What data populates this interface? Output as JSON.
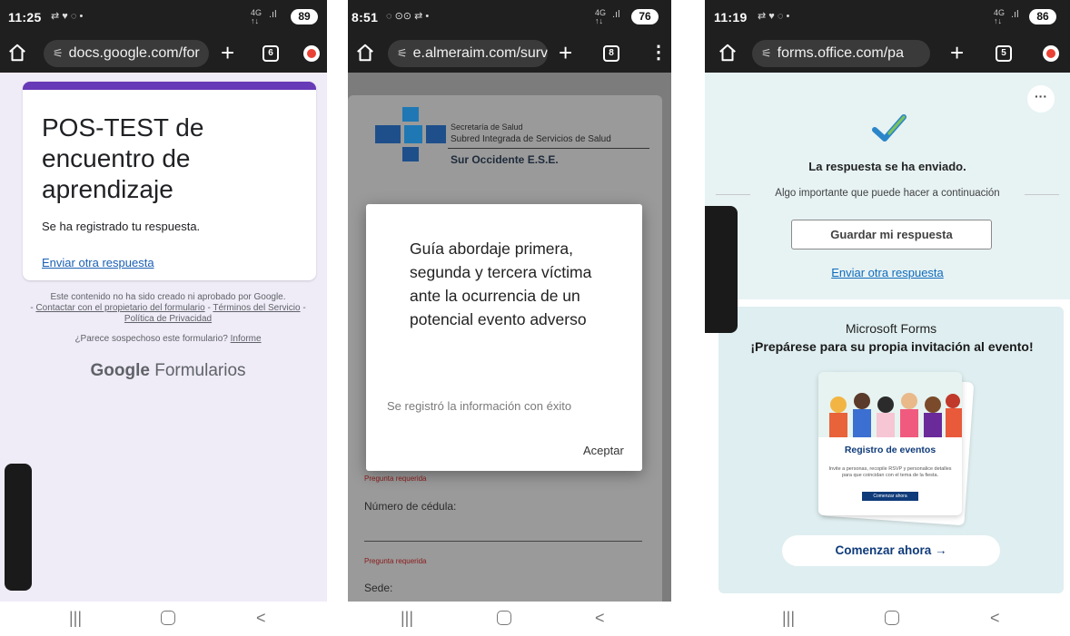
{
  "panels": {
    "google": {
      "status": {
        "time": "11:25",
        "icons": "⇄ ♥ ◌ •",
        "signal": "4G\n↑↓",
        "battery": "89"
      },
      "browser": {
        "url": "docs.google.com/for",
        "tabs_count": "6"
      },
      "form": {
        "title": "POS-TEST de encuentro de aprendizaje",
        "message": "Se ha registrado tu respuesta.",
        "link": "Enviar otra respuesta"
      },
      "footer": {
        "disclaimer_1": "Este contenido no ha sido creado ni aprobado por Google.",
        "disclaimer_2a": "- ",
        "contact_link": "Contactar con el propietario del formulario",
        "sep": " - ",
        "terms_link": "Términos del Servicio",
        "privacy_link": "Política de Privacidad",
        "suspicious": "¿Parece sospechoso este formulario? ",
        "report_link": "Informe",
        "brand_bold": "Google",
        "brand_rest": " Formularios"
      }
    },
    "almeraim": {
      "status": {
        "time": "8:51",
        "icons": "◌ ⊙⊙ ⇄ •",
        "signal": "4G\n↑↓",
        "battery": "76"
      },
      "browser": {
        "url": "e.almeraim.com/surv",
        "tabs_count": "8"
      },
      "header": {
        "line1": "Secretaría de Salud",
        "line2": "Subred Integrada de Servicios de Salud",
        "line3": "Sur Occidente E.S.E."
      },
      "fields": [
        {
          "required": "Pregunta requerida",
          "label": "Número de cédula:"
        },
        {
          "required": "Pregunta requerida",
          "label": "Sede:"
        }
      ],
      "dialog": {
        "title": "Guía abordaje primera, segunda y tercera víctima ante la ocurrencia de un potencial evento adverso",
        "message": "Se registró la información con éxito",
        "button": "Aceptar"
      }
    },
    "msforms": {
      "status": {
        "time": "11:19",
        "icons": "⇄ ♥ ◌ •",
        "signal": "4G\n↑↓",
        "battery": "86"
      },
      "browser": {
        "url": "forms.office.com/pa",
        "tabs_count": "5"
      },
      "confirmation": {
        "sent": "La respuesta se ha enviado.",
        "next": "Algo importante que puede hacer a continuación",
        "save_button": "Guardar mi respuesta",
        "again_link": "Enviar otra respuesta"
      },
      "promo": {
        "brand": "Microsoft Forms",
        "headline": "¡Prepárese para su propia invitación al evento!",
        "card_title": "Registro de eventos",
        "card_desc": "Invite a personas, recopile RSVP y personalice detalles para que coincidan con el tema de la fiesta.",
        "card_button": "Comenzar ahora",
        "start_button": "Comenzar ahora →"
      }
    }
  },
  "navbar": {
    "recents": "|||",
    "back": "<"
  },
  "colors": {
    "google_purple": "#673ab7",
    "forms_blue": "#0f3b7a",
    "link_blue": "#0f6cbd",
    "chrome_dark": "#1f1f1f"
  }
}
